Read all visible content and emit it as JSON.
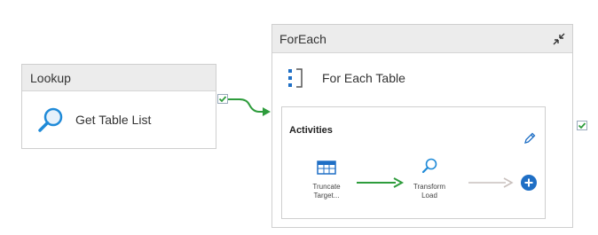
{
  "lookup": {
    "header": "Lookup",
    "name": "Get Table List",
    "icon": "search-icon"
  },
  "foreach": {
    "header": "ForEach",
    "name": "For Each Table",
    "icon": "foreach-icon",
    "collapse_icon": "collapse-icon",
    "activities": {
      "label": "Activities",
      "edit_icon": "pencil-icon",
      "items": [
        {
          "caption_line1": "Truncate",
          "caption_line2": "Target...",
          "icon": "table-icon"
        },
        {
          "caption_line1": "Transform",
          "caption_line2": "Load",
          "icon": "search-icon"
        }
      ],
      "add_icon": "add-icon"
    }
  },
  "colors": {
    "success_green": "#2e9c3c",
    "azure_blue": "#1f6fc5",
    "header_gray": "#ececec",
    "border_gray": "#cfcfcf",
    "inactive_arrow": "#c9c0bd"
  }
}
